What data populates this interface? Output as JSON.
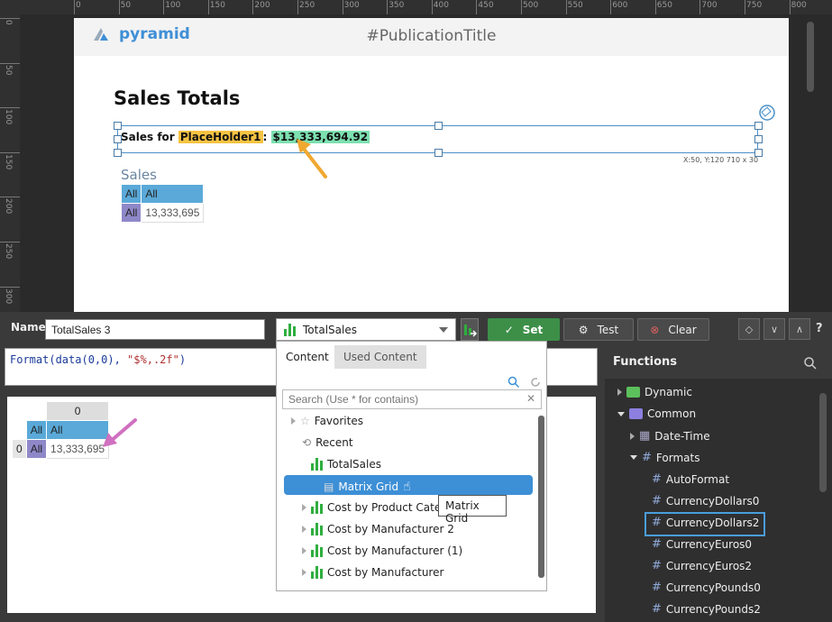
{
  "page": {
    "logo_text": "pyramid",
    "publication_title": "#PublicationTitle",
    "sales_totals_title": "Sales Totals",
    "sales_prefix": "Sales for ",
    "placeholder": "PlaceHolder1",
    "colon": ": ",
    "sales_value": "$13,333,694.92",
    "coord_readout": "X:50, Y:120 710 x 30",
    "grid_title": "Sales",
    "grid": {
      "h1": "All",
      "h2": "All",
      "row": "All",
      "value": "13,333,695"
    }
  },
  "ruler": {
    "top_ticks": [
      "0",
      "50",
      "100",
      "150",
      "200",
      "250",
      "300",
      "350",
      "400",
      "450",
      "500",
      "550",
      "600",
      "650",
      "700",
      "750",
      "800"
    ],
    "left_ticks": [
      "0",
      "50",
      "100",
      "150",
      "200",
      "250",
      "300"
    ]
  },
  "editor": {
    "name_label": "Name",
    "name_value": "TotalSales 3",
    "content_selected": "TotalSales",
    "set_label": "Set",
    "test_label": "Test",
    "clear_label": "Clear",
    "formula_fn": "Format(data(0,0), ",
    "formula_str": "\"$%,.2f\"",
    "formula_end": ")"
  },
  "preview": {
    "col": "0",
    "h1": "All",
    "h2": "All",
    "row_index": "0",
    "row": "All",
    "value": "13,333,695"
  },
  "dropdown": {
    "tab_content": "Content",
    "tab_used": "Used Content",
    "search_placeholder": "Search (Use * for contains)",
    "items": {
      "favorites": "Favorites",
      "recent": "Recent",
      "total_sales": "TotalSales",
      "matrix_grid": "Matrix Grid",
      "cost_by_product": "Cost by Product Catego",
      "cost_by_mfr2": "Cost by Manufacturer 2",
      "cost_by_mfr1": "Cost by Manufacturer (1)",
      "cost_by_mfr": "Cost by Manufacturer"
    },
    "tooltip": "Matrix Grid"
  },
  "functions": {
    "title": "Functions",
    "items": {
      "dynamic": "Dynamic",
      "common": "Common",
      "date_time": "Date-Time",
      "formats": "Formats",
      "autoformat": "AutoFormat",
      "currency_dollars0": "CurrencyDollars0",
      "currency_dollars2": "CurrencyDollars2",
      "currency_euros0": "CurrencyEuros0",
      "currency_euros2": "CurrencyEuros2",
      "currency_pounds0": "CurrencyPounds0",
      "currency_pounds2": "CurrencyPounds2"
    }
  },
  "colors": {
    "accent": "#3d8fd6",
    "set_green": "#3d8f48",
    "placeholder": "#f6c342",
    "value_highlight": "#7ce0b0",
    "annotation_orange": "#f0a830",
    "annotation_pink": "#d070c0"
  }
}
